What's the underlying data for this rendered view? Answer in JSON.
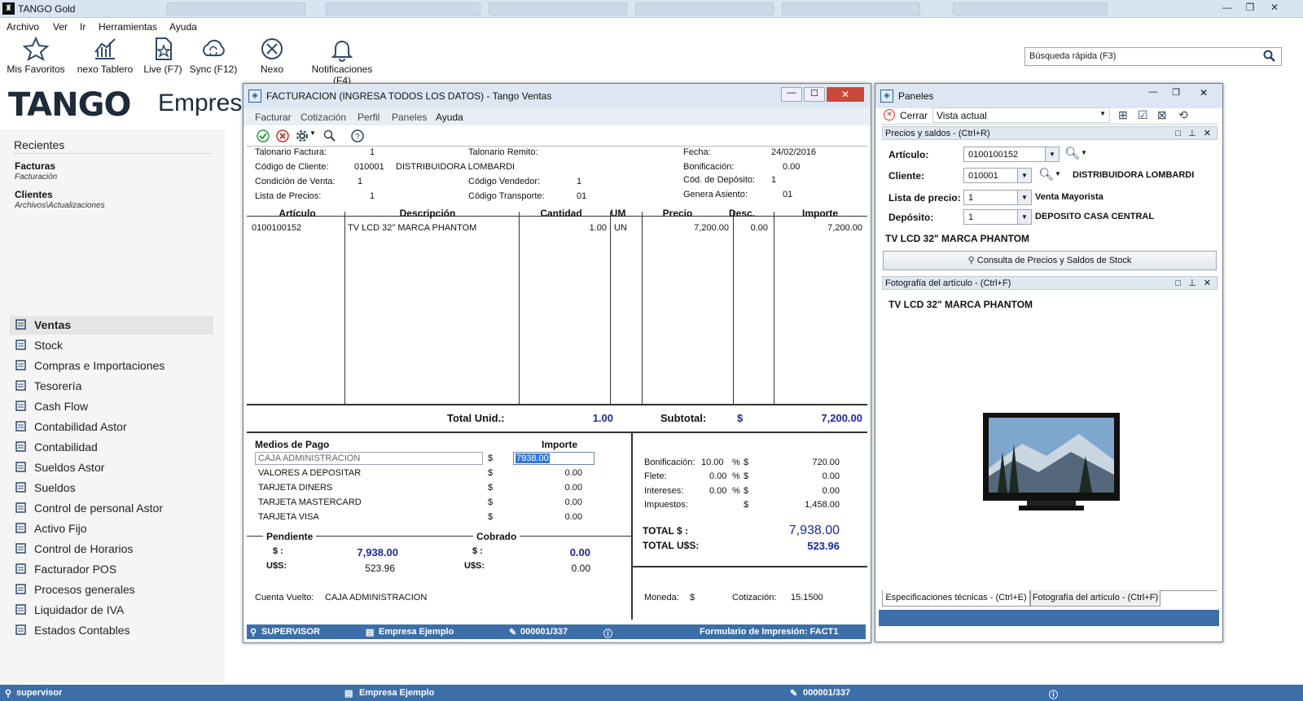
{
  "app": {
    "title": "TANGO Gold"
  },
  "menu": [
    "Archivo",
    "Ver",
    "Ir",
    "Herramientas",
    "Ayuda"
  ],
  "toolbar": [
    {
      "label": "Mis Favoritos",
      "icon": "star-icon"
    },
    {
      "label": "nexo Tablero",
      "icon": "chart-icon"
    },
    {
      "label": "Live (F7)",
      "icon": "document-star-icon"
    },
    {
      "label": "Sync (F12)",
      "icon": "cloud-sync-icon"
    },
    {
      "label": "Nexo",
      "icon": "nexo-icon"
    },
    {
      "label": "Notificaciones (F4)",
      "icon": "bell-icon"
    }
  ],
  "search": {
    "placeholder": "Búsqueda rápida (F3)"
  },
  "brand": {
    "logo": "TANGO",
    "product": "Empresa"
  },
  "recientes": {
    "title": "Recientes",
    "items": [
      {
        "name": "Facturas",
        "path": "Facturación"
      },
      {
        "name": "Clientes",
        "path": "Archivos\\Actualizaciones"
      }
    ]
  },
  "nav": [
    "Ventas",
    "Stock",
    "Compras e Importaciones",
    "Tesorería",
    "Cash Flow",
    "Contabilidad Astor",
    "Contabilidad",
    "Sueldos Astor",
    "Sueldos",
    "Control de personal Astor",
    "Activo Fijo",
    "Control de Horarios",
    "Facturador POS",
    "Procesos generales",
    "Liquidador de IVA",
    "Estados Contables"
  ],
  "status": {
    "user": "supervisor",
    "company": "Empresa Ejemplo",
    "doc": "000001/337"
  },
  "factura": {
    "title": "FACTURACION (INGRESA TODOS LOS DATOS) - Tango Ventas",
    "menu": [
      "Facturar",
      "Cotización",
      "Perfil",
      "Paneles",
      "Ayuda"
    ],
    "header": {
      "talonario_factura_lbl": "Talonario Factura:",
      "talonario_factura": "1",
      "codigo_cliente_lbl": "Código de Cliente:",
      "codigo_cliente": "010001",
      "cliente_nombre": "DISTRIBUIDORA LOMBARDI",
      "condicion_venta_lbl": "Condición de Venta:",
      "condicion_venta": "1",
      "lista_precios_lbl": "Lista de Precios:",
      "lista_precios": "1",
      "talonario_remito_lbl": "Talonario Remito:",
      "codigo_vendedor_lbl": "Código Vendedor:",
      "codigo_vendedor": "1",
      "codigo_transporte_lbl": "Código Transporte:",
      "codigo_transporte": "01",
      "fecha_lbl": "Fecha:",
      "fecha": "24/02/2016",
      "bonificacion_lbl": "Bonificación:",
      "bonificacion": "0.00",
      "cod_deposito_lbl": "Cód. de Depósito:",
      "cod_deposito": "1",
      "genera_asiento_lbl": "Genera Asiento:",
      "genera_asiento": "01"
    },
    "columns": [
      "Artículo",
      "Descripción",
      "Cantidad",
      "UM",
      "Precio",
      "Desc.",
      "Importe"
    ],
    "rows": [
      {
        "articulo": "0100100152",
        "descripcion": "TV LCD 32\" MARCA PHANTOM",
        "cantidad": "1.00",
        "um": "UN",
        "precio": "7,200.00",
        "desc": "0.00",
        "importe": "7,200.00"
      }
    ],
    "total_unid_lbl": "Total Unid.:",
    "total_unid": "1.00",
    "subtotal_lbl": "Subtotal:",
    "currency": "$",
    "subtotal": "7,200.00",
    "medios_lbl": "Medios de Pago",
    "importe_lbl": "Importe",
    "medios": [
      {
        "name": "CAJA ADMINISTRACION",
        "cur": "$",
        "value": "7938.00"
      },
      {
        "name": "VALORES A DEPOSITAR",
        "cur": "$",
        "value": "0.00"
      },
      {
        "name": "TARJETA DINERS",
        "cur": "$",
        "value": "0.00"
      },
      {
        "name": "TARJETA MASTERCARD",
        "cur": "$",
        "value": "0.00"
      },
      {
        "name": "TARJETA VISA",
        "cur": "$",
        "value": "0.00"
      }
    ],
    "pendiente_lbl": "Pendiente",
    "cobrado_lbl": "Cobrado",
    "pend_ars_lbl": "$ :",
    "pend_ars": "7,938.00",
    "pend_usd_lbl": "U$S:",
    "pend_usd": "523.96",
    "cob_ars_lbl": "$ :",
    "cob_ars": "0.00",
    "cob_usd_lbl": "U$S:",
    "cob_usd": "0.00",
    "cuenta_vuelto_lbl": "Cuenta Vuelto:",
    "cuenta_vuelto": "CAJA ADMINISTRACION",
    "bonif_lbl": "Bonificación:",
    "bonif_pct": "10.00",
    "bonif_val": "720.00",
    "flete_lbl": "Flete:",
    "flete_pct": "0.00",
    "flete_val": "0.00",
    "intereses_lbl": "Intereses:",
    "intereses_pct": "0.00",
    "intereses_val": "0.00",
    "impuestos_lbl": "Impuestos:",
    "impuestos_val": "1,458.00",
    "pct": "%",
    "cur": "$",
    "total_lbl": "TOTAL  $ :",
    "total": "7,938.00",
    "total_usd_lbl": "TOTAL U$S:",
    "total_usd": "523.96",
    "moneda_lbl": "Moneda:",
    "moneda": "$",
    "cotizacion_lbl": "Cotización:",
    "cotizacion": "15.1500",
    "status_user": "SUPERVISOR",
    "status_company": "Empresa Ejemplo",
    "status_doc": "000001/337",
    "status_form": "Formulario de Impresión: FACT1"
  },
  "paneles": {
    "title": "Paneles",
    "cerrar": "Cerrar",
    "vista": "Vista actual",
    "precios_title": "Precios y saldos - (Ctrl+R)",
    "articulo_lbl": "Artículo:",
    "articulo": "0100100152",
    "cliente_lbl": "Cliente:",
    "cliente": "010001",
    "cliente_nombre": "DISTRIBUIDORA LOMBARDI",
    "lista_lbl": "Lista de precio:",
    "lista": "1",
    "lista_nombre": "Venta Mayorista",
    "deposito_lbl": "Depósito:",
    "deposito": "1",
    "deposito_nombre": "DEPOSITO CASA CENTRAL",
    "producto": "TV LCD 32\" MARCA PHANTOM",
    "consulta_btn": "Consulta de Precios y Saldos de Stock",
    "foto_title": "Fotografía del artículo - (Ctrl+F)",
    "foto_producto": "TV LCD 32\" MARCA PHANTOM",
    "tab_spec": "Especificaciones técnicas - (Ctrl+E)",
    "tab_foto": "Fotografía del artículo - (Ctrl+F)"
  }
}
